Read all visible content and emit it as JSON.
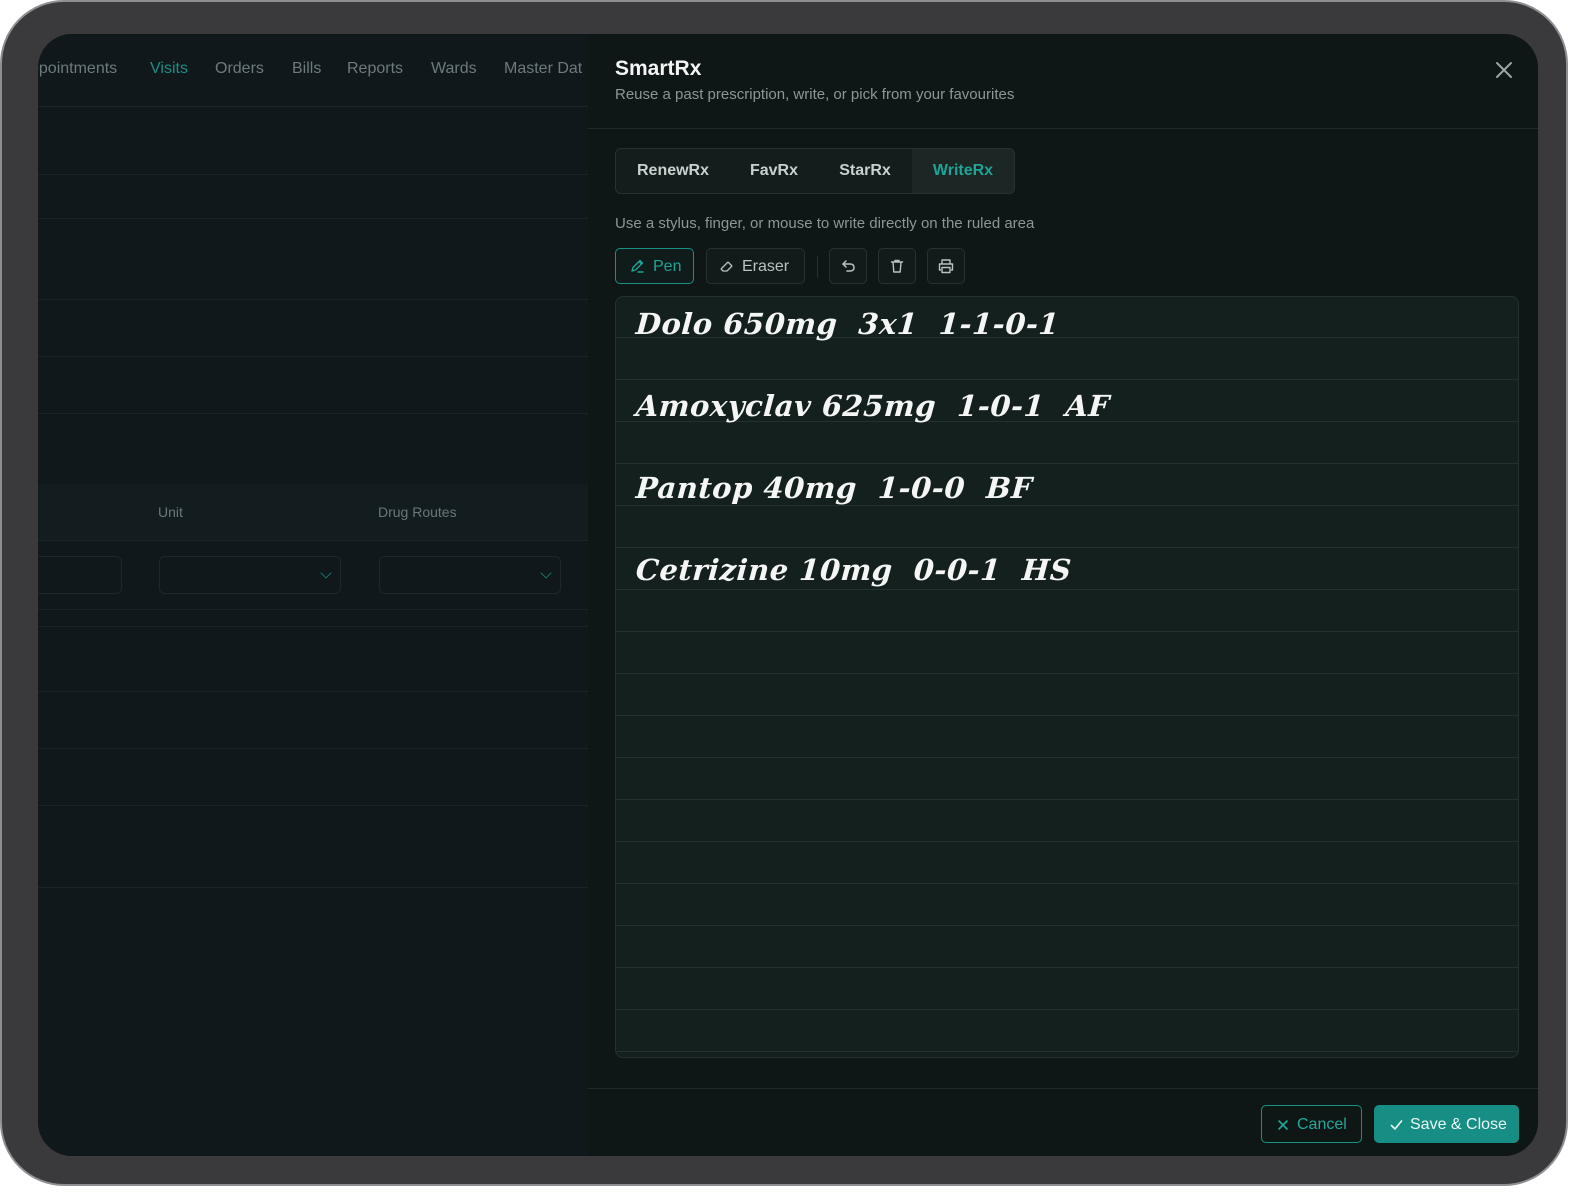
{
  "background_app": {
    "nav": [
      "ppointments",
      "Visits",
      "Orders",
      "Bills",
      "Reports",
      "Wards",
      "Master Dat"
    ],
    "active_nav": "Visits",
    "table_headers": {
      "unit": "Unit",
      "drug_routes": "Drug Routes"
    }
  },
  "panel": {
    "title": "SmartRx",
    "subtitle": "Reuse a past prescription, write, or pick from your favourites",
    "tabs": [
      "RenewRx",
      "FavRx",
      "StarRx",
      "WriteRx"
    ],
    "active_tab": "WriteRx",
    "hint": "Use a stylus, finger, or mouse to write directly on the ruled area",
    "tools": {
      "pen": "Pen",
      "eraser": "Eraser"
    },
    "tool_icons": [
      "pen-icon",
      "eraser-icon",
      "undo-icon",
      "trash-icon",
      "print-icon"
    ],
    "handwriting": [
      "Dolo 650mg  3x1  1-1-0-1",
      "Amoxyclav 625mg  1-0-1  AF",
      "Pantop 40mg  1-0-0  BF",
      "Cetrizine 10mg  0-0-1  HS"
    ],
    "footer": {
      "cancel": "Cancel",
      "save": "Save & Close"
    }
  },
  "colors": {
    "accent": "#178e83",
    "panel_bg": "#0f1716",
    "canvas_bg": "#14201d"
  }
}
